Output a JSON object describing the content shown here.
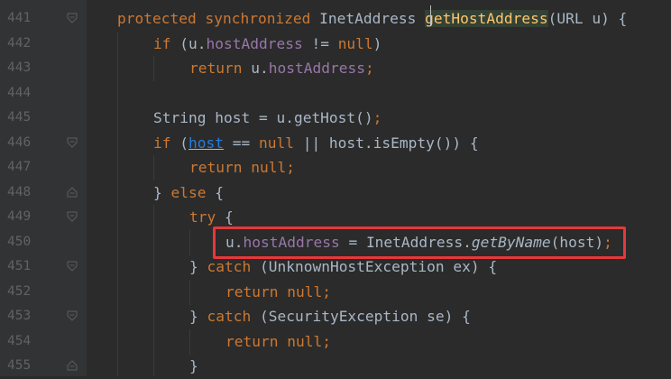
{
  "lines": [
    {
      "num": "441",
      "tokens": [
        "protected",
        " ",
        "synchronized",
        " InetAddress ",
        "getHostAddress",
        "(URL ",
        "u",
        ") {"
      ]
    },
    {
      "num": "442",
      "tokens": [
        "if",
        " (",
        "u",
        ".",
        "hostAddress",
        " != ",
        "null",
        ")"
      ]
    },
    {
      "num": "443",
      "tokens": [
        "return",
        " ",
        "u",
        ".",
        "hostAddress",
        ";"
      ]
    },
    {
      "num": "444",
      "tokens": []
    },
    {
      "num": "445",
      "tokens": [
        "String host = ",
        "u",
        ".getHost()",
        ";"
      ]
    },
    {
      "num": "446",
      "tokens": [
        "if",
        " (",
        "host",
        " == ",
        "null",
        " || host.isEmpty()) {"
      ]
    },
    {
      "num": "447",
      "tokens": [
        "return",
        " ",
        "null",
        ";"
      ]
    },
    {
      "num": "448",
      "tokens": [
        "} ",
        "else",
        " {"
      ]
    },
    {
      "num": "449",
      "tokens": [
        "try",
        " {"
      ]
    },
    {
      "num": "450",
      "tokens": [
        "u",
        ".",
        "hostAddress",
        " = InetAddress.",
        "getByName",
        "(host)",
        ";"
      ]
    },
    {
      "num": "451",
      "tokens": [
        "} ",
        "catch",
        " (UnknownHostException ex) {"
      ]
    },
    {
      "num": "452",
      "tokens": [
        "return",
        " ",
        "null",
        ";"
      ]
    },
    {
      "num": "453",
      "tokens": [
        "} ",
        "catch",
        " (SecurityException se) {"
      ]
    },
    {
      "num": "454",
      "tokens": [
        "return",
        " ",
        "null",
        ";"
      ]
    },
    {
      "num": "455",
      "tokens": [
        "}"
      ]
    }
  ],
  "colors": {
    "background": "#2b2b2b",
    "keyword": "#cc7832",
    "field": "#9876aa",
    "method_declaration": "#ffc66d",
    "plain": "#a9b7c6",
    "highlight_box": "#e5383b"
  },
  "highlighted_line": "450"
}
